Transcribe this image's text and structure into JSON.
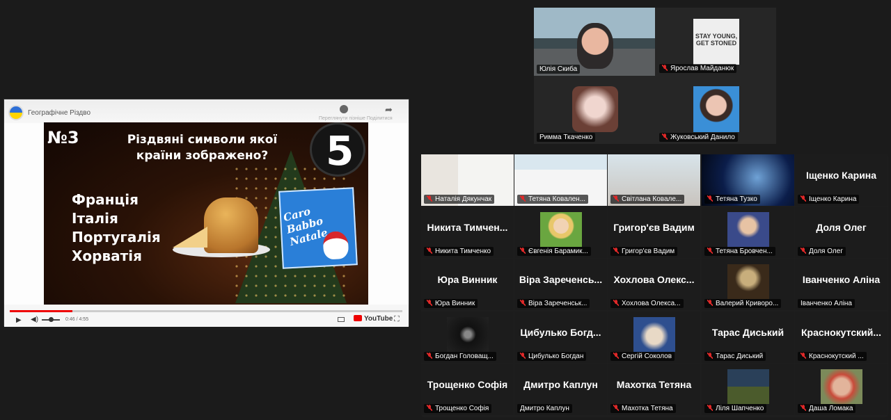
{
  "shared_screen": {
    "video_title": "Географічне Різдво",
    "actions_text": "Переглянути пізніше  Поділитися",
    "slide": {
      "number": "№3",
      "question": "Різдвяні символи якої країни зображено?",
      "logo": "5",
      "options": [
        "Франція",
        "Італія",
        "Португалія",
        "Хорватія"
      ],
      "book_title": "Caro Babbo Natale..."
    },
    "player": {
      "time": "0:46 / 4:55",
      "progress": 0.16,
      "brand": "YouTube"
    }
  },
  "speakers": [
    {
      "name": "Юлія Скиба",
      "muted": false,
      "active": true
    },
    {
      "name": "Ярослав Майданюк",
      "muted": true,
      "sign_text": "STAY YOUNG, GET STONED"
    },
    {
      "name": "Римма Ткаченко",
      "muted": false
    },
    {
      "name": "Жуковський Данило",
      "muted": true
    }
  ],
  "attendees": [
    {
      "label": "Наталія Дякунчак",
      "muted": true
    },
    {
      "label": "Тетяна  Ковален...",
      "muted": true
    },
    {
      "label": "Світлана Ковале...",
      "muted": true
    },
    {
      "label": "Тетяна Тузко",
      "muted": true
    },
    {
      "label": "Іщенко Карина",
      "muted": true,
      "big": "Іщенко Карина"
    },
    {
      "label": "Никита Тимченко",
      "muted": true,
      "big": "Никита  Тимчен..."
    },
    {
      "label": "Євгенія Барамик...",
      "muted": true
    },
    {
      "label": "Григор'єв Вадим",
      "muted": true,
      "big": "Григор'єв Вадим"
    },
    {
      "label": "Тетяна Бровчен...",
      "muted": true
    },
    {
      "label": "Доля Олег",
      "muted": true,
      "big": "Доля Олег"
    },
    {
      "label": "Юра Винник",
      "muted": true,
      "big": "Юра Винник"
    },
    {
      "label": "Віра Зареченськ...",
      "muted": true,
      "big": "Віра  Зареченсь..."
    },
    {
      "label": "Хохлова Олекса...",
      "muted": true,
      "big": "Хохлова  Олекс..."
    },
    {
      "label": "Валерий Криворо...",
      "muted": true
    },
    {
      "label": "Іванченко Аліна",
      "muted": false,
      "big": "Іванченко Аліна"
    },
    {
      "label": "Богдан Головащ...",
      "muted": true
    },
    {
      "label": "Цибулько Богдан",
      "muted": true,
      "big": "Цибулько  Богд..."
    },
    {
      "label": "Сергій Соколов",
      "muted": true
    },
    {
      "label": "Тарас Диський",
      "muted": true,
      "big": "Тарас Диський"
    },
    {
      "label": "Краснокутский ...",
      "muted": true,
      "big": "Краснокутский..."
    },
    {
      "label": "Трощенко Софія",
      "muted": true,
      "big": "Трощенко Софія"
    },
    {
      "label": "Дмитро Каплун",
      "muted": false,
      "big": "Дмитро Каплун"
    },
    {
      "label": "Махотка Тетяна",
      "muted": true,
      "big": "Махотка Тетяна"
    },
    {
      "label": "Ліля Шапченко",
      "muted": true
    },
    {
      "label": "Даша Ломака",
      "muted": true
    }
  ]
}
